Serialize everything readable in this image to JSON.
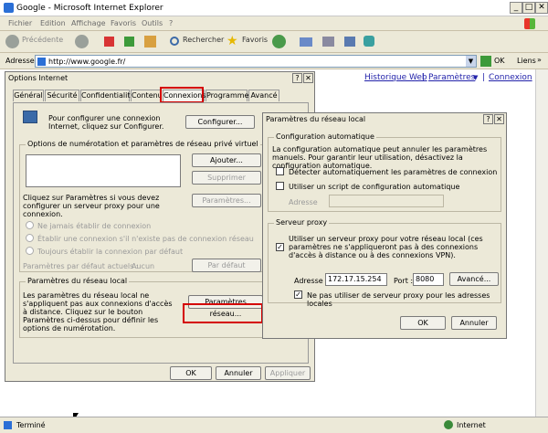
{
  "ie": {
    "title": "Google - Microsoft Internet Explorer",
    "menu": [
      "Fichier",
      "Edition",
      "Affichage",
      "Favoris",
      "Outils",
      "?"
    ],
    "toolbar": {
      "back": "Précédente",
      "search": "Rechercher",
      "favorites": "Favoris"
    },
    "address_label": "Adresse",
    "address_value": "http://www.google.fr/",
    "go_label": "OK",
    "links_label": "Liens",
    "status_left": "Terminé",
    "status_zone": "Internet",
    "page_links": [
      "Historique Web",
      "Paramètres",
      "Connexion"
    ],
    "page_sep": "|",
    "page_arrow": "▼"
  },
  "options": {
    "title": "Options Internet",
    "tabs": [
      "Général",
      "Sécurité",
      "Confidentialité",
      "Contenu",
      "Connexions",
      "Programmes",
      "Avancé"
    ],
    "setup_text": "Pour configurer une connexion Internet, cliquez sur Configurer.",
    "setup_button": "Configurer...",
    "dialup_group": "Options de numérotation et paramètres de réseau privé virtuel",
    "add_button": "Ajouter...",
    "remove_button": "Supprimer",
    "params_text": "Cliquez sur Paramètres si vous devez configurer un serveur proxy pour une connexion.",
    "params_button": "Paramètres...",
    "radio1": "Ne jamais établir de connexion",
    "radio2": "Établir une connexion s'il n'existe pas de connexion réseau",
    "radio3": "Toujours établir la connexion par défaut",
    "current_default_label": "Paramètres par défaut actuels :",
    "current_default_value": "Aucun",
    "default_button": "Par défaut",
    "lan_group": "Paramètres du réseau local",
    "lan_text": "Les paramètres du réseau local ne s'appliquent pas aux connexions d'accès à distance. Cliquez sur le bouton Paramètres ci-dessus pour définir les options de numérotation.",
    "lan_button": "Paramètres réseau...",
    "ok": "OK",
    "cancel": "Annuler",
    "apply": "Appliquer"
  },
  "lan": {
    "title": "Paramètres du réseau local",
    "auto_group": "Configuration automatique",
    "auto_text": "La configuration automatique peut annuler les paramètres manuels. Pour garantir leur utilisation, désactivez la configuration automatique.",
    "detect_label": "Détecter automatiquement les paramètres de connexion",
    "script_label": "Utiliser un script de configuration automatique",
    "address_label": "Adresse",
    "proxy_group": "Serveur proxy",
    "proxy_label": "Utiliser un serveur proxy pour votre réseau local (ces paramètres ne s'appliqueront pas à des connexions d'accès à distance ou à des connexions VPN).",
    "proxy_address_label": "Adresse :",
    "proxy_address_value": "172.17.15.254",
    "port_label": "Port :",
    "port_value": "8080",
    "advanced_button": "Avancé...",
    "bypass_label": "Ne pas utiliser de serveur proxy pour les adresses locales",
    "ok": "OK",
    "cancel": "Annuler",
    "check_mark": "✓"
  },
  "colors": {
    "highlight": "#d40000",
    "link": "#2222aa",
    "chrome": "#ece9d8"
  }
}
